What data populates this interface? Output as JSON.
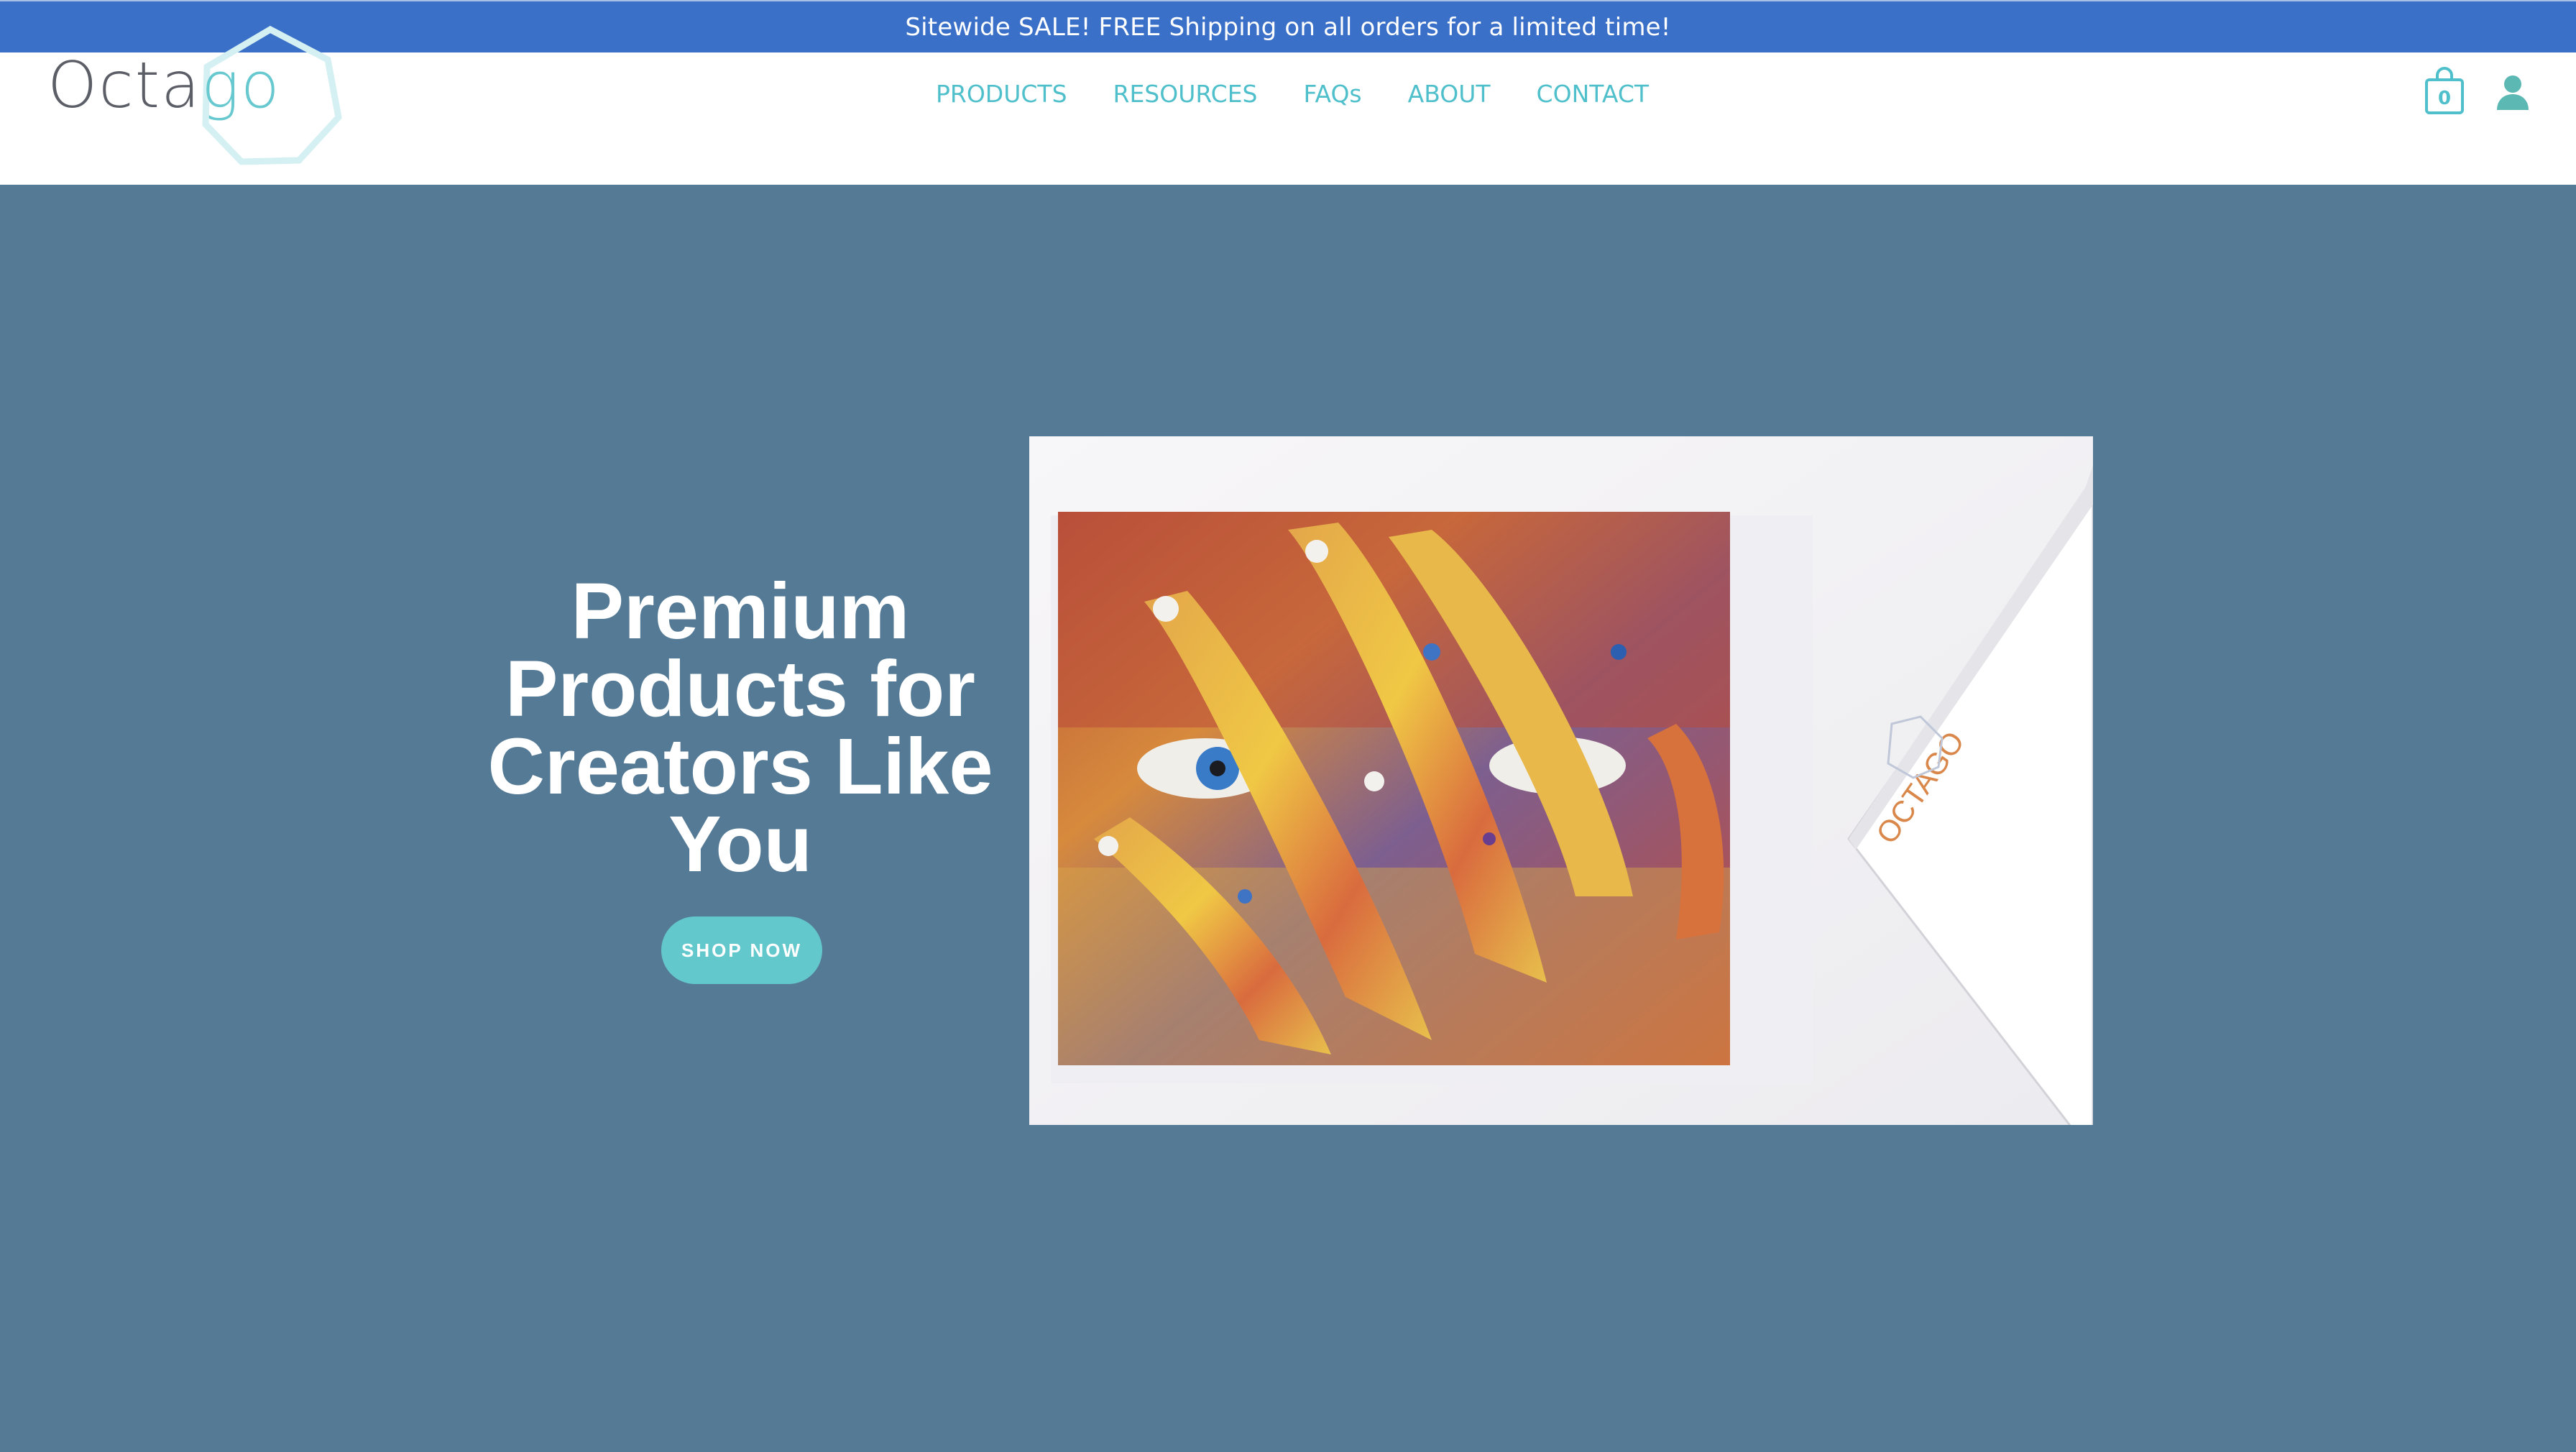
{
  "announcement": {
    "text": "Sitewide SALE! FREE Shipping on all orders for a limited time!"
  },
  "header": {
    "logo": {
      "text_dark": "Octa",
      "text_teal": "go"
    },
    "nav": [
      {
        "label": "PRODUCTS"
      },
      {
        "label": "RESOURCES"
      },
      {
        "label": "FAQs"
      },
      {
        "label": "ABOUT"
      },
      {
        "label": "CONTACT"
      }
    ],
    "cart": {
      "icon": "shopping-bag-icon",
      "count": "0"
    },
    "account": {
      "icon": "user-icon"
    }
  },
  "hero": {
    "heading": "Premium Products for Creators Like You",
    "cta_label": "SHOP NOW",
    "image": {
      "box_logo_text": "OCTAGO"
    }
  },
  "colors": {
    "announcement_bg": "#3b70c9",
    "hero_bg": "#557a95",
    "accent_teal": "#4fc0cb",
    "button_bg": "#62c8cc",
    "logo_dark": "#5b5e66"
  }
}
